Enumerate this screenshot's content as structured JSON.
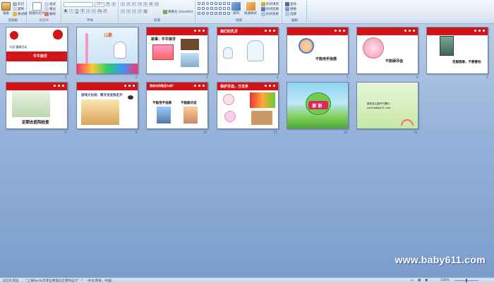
{
  "ribbon": {
    "clipboard": {
      "label": "剪贴板",
      "paste": "粘贴",
      "cut": "剪切",
      "copy": "复制",
      "format_painter": "格式刷"
    },
    "slides": {
      "label": "幻灯片",
      "new_slide": "新建幻灯片",
      "layout": "版式",
      "reset": "重设",
      "delete": "删除"
    },
    "font": {
      "label": "字体",
      "font_name": "",
      "font_size": "24+"
    },
    "paragraph": {
      "label": "段落",
      "smartart": "转换为 SmartArt"
    },
    "drawing": {
      "label": "绘图",
      "arrange": "排列",
      "quick_styles": "快速样式",
      "fill": "形状填充",
      "outline": "形状轮廓",
      "effects": "形状效果"
    },
    "editing": {
      "label": "编辑",
      "find": "查找",
      "replace": "替换",
      "select": "选择"
    }
  },
  "slides": [
    {
      "number": "1",
      "text": [
        "大班 健康活动",
        "牛牛换牙"
      ]
    },
    {
      "number": "2",
      "text": [
        "儿歌"
      ]
    },
    {
      "number": "3",
      "text": [
        "故事：牛牛换牙"
      ]
    },
    {
      "number": "4",
      "text": [
        "我们的乳牙"
      ]
    },
    {
      "number": "5",
      "text": [
        "不能用手指摸"
      ]
    },
    {
      "number": "6",
      "text": [
        "不能舔牙齿"
      ]
    },
    {
      "number": "7",
      "text": [
        "克服困难，不要害怕"
      ]
    },
    {
      "number": "8",
      "text": [
        "定期去医院检查"
      ]
    },
    {
      "number": "9",
      "text": [
        "游戏大比拼：帮牙宝宝快走开"
      ]
    },
    {
      "number": "10",
      "text": [
        "我来对你做怎么样？",
        "不能用手指摸",
        "不能舔牙齿"
      ]
    },
    {
      "number": "11",
      "text": [
        "保护牙齿，方法多"
      ]
    },
    {
      "number": "12",
      "text": [
        "谢 谢"
      ]
    },
    {
      "number": "13",
      "text": [
        "更多幼儿园PPT课件：",
        "www.baby611.com"
      ]
    }
  ],
  "watermark": "www.baby611.com",
  "status": {
    "slide_view": "幻灯片浏览",
    "theme": "\"上海Nurds华专业简笔幻灯课件设计\"",
    "language": "中文(简体，中国)",
    "zoom": "100%"
  }
}
